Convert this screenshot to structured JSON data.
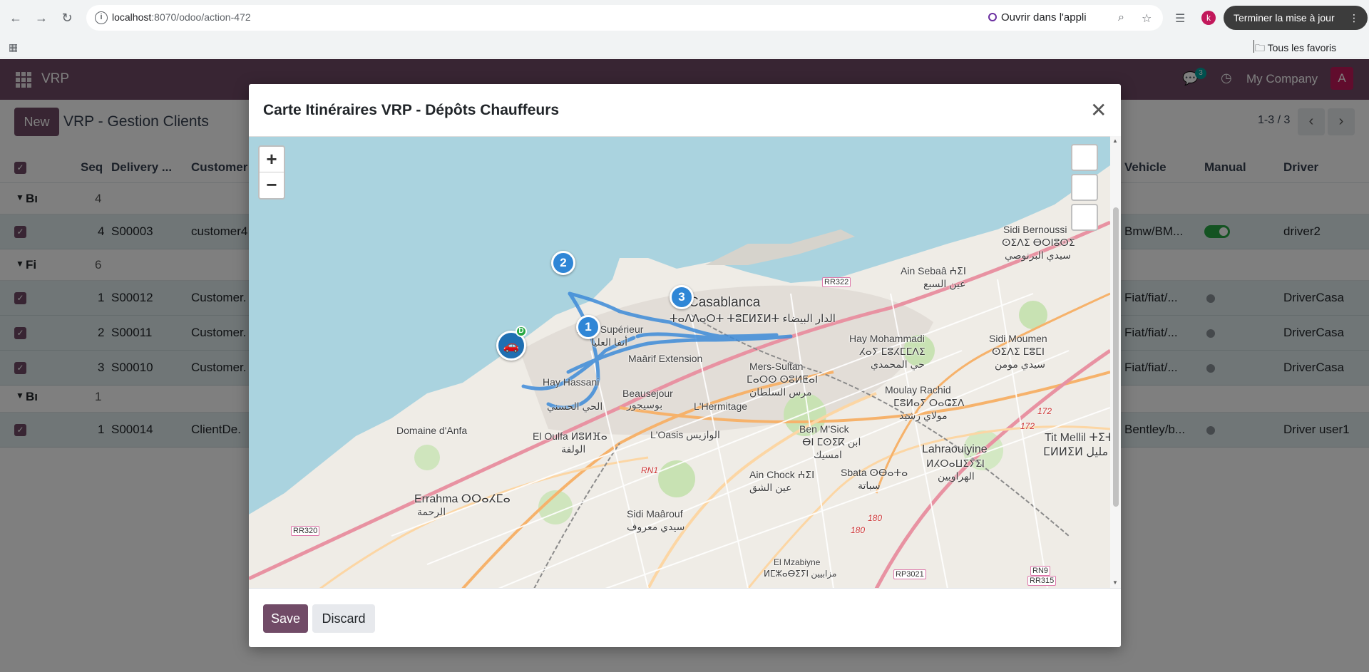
{
  "browser": {
    "url_host": "localhost",
    "url_path": ":8070/odoo/action-472",
    "open_in_app": "Ouvrir dans l'appli",
    "profile_initial": "k",
    "update_label": "Terminer la mise à jour",
    "bookmarks_all": "Tous les favoris"
  },
  "odoo_nav": {
    "app_name": "VRP",
    "chat_badge": "3",
    "company": "My Company",
    "avatar_initial": "A"
  },
  "control_panel": {
    "new_label": "New",
    "title": "VRP - Gestion Clients",
    "pager": "1-3 / 3"
  },
  "list": {
    "headers": {
      "seq": "Seq",
      "delivery": "Delivery ...",
      "customer": "Customer",
      "vehicle": "Vehicle",
      "manual": "Manual",
      "driver": "Driver"
    },
    "groups": [
      {
        "name": "Bı",
        "count": "4"
      },
      {
        "name": "Fi",
        "count": "6"
      },
      {
        "name": "Bı",
        "count": "1"
      }
    ],
    "rows": [
      {
        "seq": "4",
        "delivery": "S00003",
        "customer": "customer4",
        "vehicle": "Bmw/BM...",
        "driver": "driver2"
      },
      {
        "seq": "1",
        "delivery": "S00012",
        "customer": "Customer.",
        "vehicle": "Fiat/fiat/...",
        "driver": "DriverCasa"
      },
      {
        "seq": "2",
        "delivery": "S00011",
        "customer": "Customer.",
        "vehicle": "Fiat/fiat/...",
        "driver": "DriverCasa"
      },
      {
        "seq": "3",
        "delivery": "S00010",
        "customer": "Customer.",
        "vehicle": "Fiat/fiat/...",
        "driver": "DriverCasa"
      },
      {
        "seq": "1",
        "delivery": "S00014",
        "customer": "ClientDe.",
        "vehicle": "Bentley/b...",
        "driver": "Driver user1"
      }
    ]
  },
  "modal": {
    "title": "Carte Itinéraires VRP - Dépôts Chauffeurs",
    "save_label": "Save",
    "discard_label": "Discard",
    "zoom_in": "+",
    "zoom_out": "−",
    "stops": [
      "1",
      "2",
      "3"
    ],
    "depot_badge": "D",
    "route_color": "#3d8bd9",
    "labels": {
      "casablanca": "Casablanca",
      "casablanca_local": "ⵜⴰⴷⴷⴰⵔⵜ ⵜⵓⵎⵍⵉⵍⵜ الدار البيضاء",
      "anfa_sup": "Anfa Supérieur",
      "anfa_sup_ar": "أنفا العليا",
      "maarif": "Maârif Extension",
      "beausejour": "Beausejour",
      "beausejour_ar": "بوسيجور",
      "hay_hassani": "Hay Hassani",
      "hay_hassani_ar": "الحي الحسني",
      "domaine_anfa": "Domaine d'Anfa",
      "el_oulfa": "El Oulfa ⵍⵓⵍⴼⴰ",
      "el_oulfa_ar": "الولفة",
      "oasis": "L'Oasis الوازيس",
      "hermitage": "L'Hermitage",
      "mers_sultan": "Mers-Sultan",
      "mers_sultan_local": "ⵎⴰⵔⵙ ⵙⵓⵍⵟⴰⵏ",
      "mers_sultan_ar": "مرس السلطان",
      "hay_mohammadi": "Hay Mohammadi",
      "hay_mohammadi_local": "ⵃⴰⵢ ⵎⵓⵃⵎⵎⴷⵉ",
      "hay_mohammadi_ar": "حي المحمدي",
      "sidi_moumen": "Sidi Moumen",
      "sidi_moumen_local": "ⵙⵉⴷⵉ ⵎⵓⵎⵏ",
      "sidi_moumen_ar": "سيدي مومن",
      "moulay_rachid": "Moulay Rachid",
      "moulay_rachid_local": "ⵎⵓⵍⴰⵢ ⵔⴰⵛⵉⴷ",
      "moulay_rachid_ar": "مولاي رشيد",
      "ain_sebaa": "Ain Sebaâ ⵄⵉⵏ",
      "ain_sebaa_ar": "عين السبع",
      "sidi_bernoussi": "Sidi Bernoussi",
      "sidi_bernoussi_local": "ⵙⵉⴷⵉ ⴱⵔⵏⵓⵙⵉ",
      "sidi_bernoussi_ar": "سيدي البرنوصي",
      "ben_msick": "Ben M'Sick",
      "ben_msick_local": "ⴱⵏ ⵎⵙⵉⴽ ابن",
      "ben_msick_ar": "امسيك",
      "ain_chock": "Ain Chock ⵄⵉⵏ",
      "ain_chock_ar": "عين الشق",
      "sbata": "Sbata ⵙⴱⴰⵜⴰ",
      "sbata_ar": "سباتة",
      "lahraouiyine": "Lahraouiyine",
      "lahraouiyine_local": "ⵍⵃⵔⴰⵡⵉⵢⵉⵏ",
      "lahraouiyine_ar": "الهراويين",
      "errahma": "Errahma ⵔⵔⴰⵃⵎⴰ",
      "errahma_ar": "الرحمة",
      "sidi_maarouf": "Sidi Maârouf",
      "sidi_maarouf_ar": "سيدي معروف",
      "el_mzabiyne": "El Mzabiyne",
      "el_mzabiyne_local": "ⵍⵎⵣⴰⴱⵉⵢⵏ مزابيين",
      "tit_mellil": "Tit Mellil ⵜⵉⵜ",
      "tit_mellil_local": "ⵎⵍⵍⵉⵍ بط مليل",
      "rr322": "RR322",
      "rr320": "RR320",
      "rp3021": "RP3021",
      "rn9": "RN9",
      "rr315": "RR315",
      "rn1": "RN1",
      "r172a": "172",
      "r172b": "172",
      "r180a": "180",
      "r180b": "180"
    }
  }
}
